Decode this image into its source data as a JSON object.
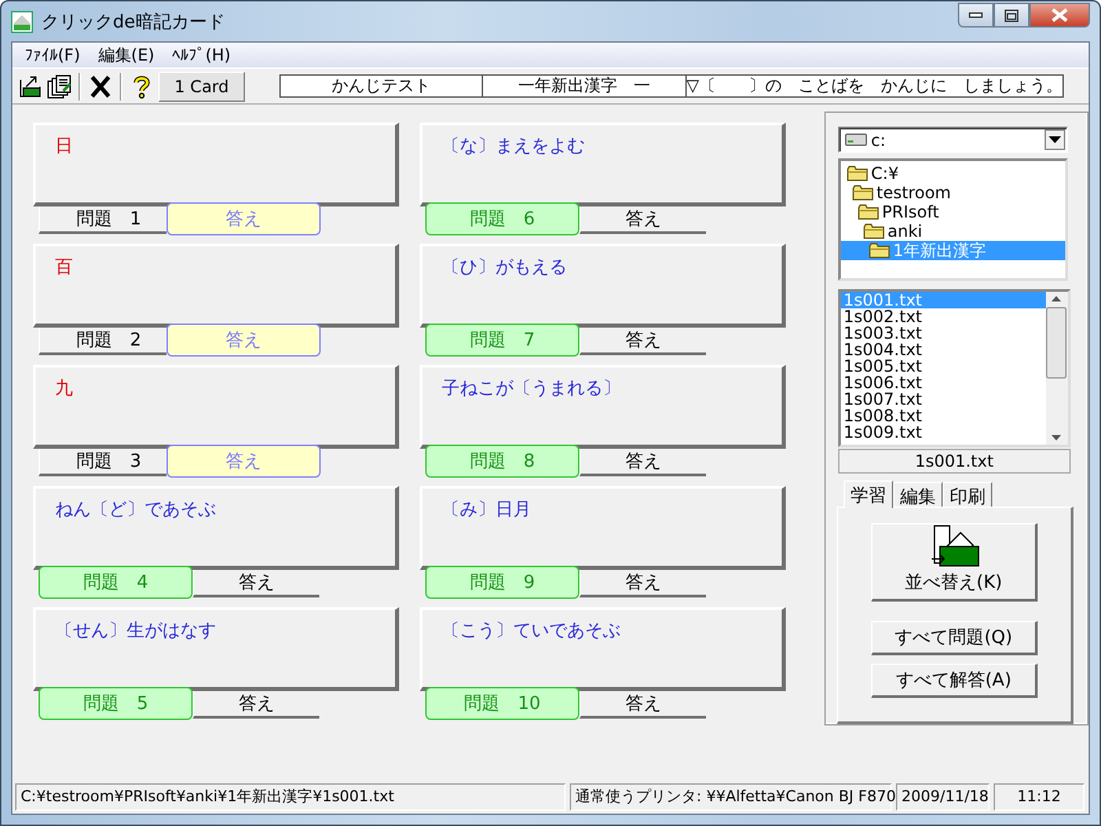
{
  "window": {
    "title": "クリックde暗記カード"
  },
  "menu": [
    {
      "label": "ﾌｧｲﾙ(F)"
    },
    {
      "label": "編集(E)"
    },
    {
      "label": "ﾍﾙﾌﾟ(H)"
    }
  ],
  "toolbar": {
    "card_count": "1 Card",
    "fields": [
      "かんじテスト",
      "一年新出漢字　一",
      "▽〔　　〕の　ことばを　かんじに　しましょう。"
    ]
  },
  "cards": [
    {
      "text": "日",
      "tabs": [
        {
          "label": "問題　1",
          "selected": false
        },
        {
          "label": "答え",
          "selected": true
        }
      ]
    },
    {
      "text": "百",
      "tabs": [
        {
          "label": "問題　2",
          "selected": false
        },
        {
          "label": "答え",
          "selected": true
        }
      ]
    },
    {
      "text": "九",
      "tabs": [
        {
          "label": "問題　3",
          "selected": false
        },
        {
          "label": "答え",
          "selected": true
        }
      ]
    },
    {
      "text": "ねん〔ど〕であそぶ",
      "tabs": [
        {
          "label": "問題　4",
          "selected": true
        },
        {
          "label": "答え",
          "selected": false
        }
      ]
    },
    {
      "text": "〔せん〕生がはなす",
      "tabs": [
        {
          "label": "問題　5",
          "selected": true
        },
        {
          "label": "答え",
          "selected": false
        }
      ]
    },
    {
      "text": "〔な〕まえをよむ",
      "tabs": [
        {
          "label": "問題　6",
          "selected": true
        },
        {
          "label": "答え",
          "selected": false
        }
      ]
    },
    {
      "text": "〔ひ〕がもえる",
      "tabs": [
        {
          "label": "問題　7",
          "selected": true
        },
        {
          "label": "答え",
          "selected": false
        }
      ]
    },
    {
      "text": "子ねこが〔うまれる〕",
      "tabs": [
        {
          "label": "問題　8",
          "selected": true
        },
        {
          "label": "答え",
          "selected": false
        }
      ]
    },
    {
      "text": "〔み〕日月",
      "tabs": [
        {
          "label": "問題　9",
          "selected": true
        },
        {
          "label": "答え",
          "selected": false
        }
      ]
    },
    {
      "text": "〔こう〕ていであそぶ",
      "tabs": [
        {
          "label": "問題　10",
          "selected": true
        },
        {
          "label": "答え",
          "selected": false
        }
      ]
    }
  ],
  "sidebar": {
    "drive": "c:",
    "folders": [
      {
        "label": "C:¥",
        "selected": false,
        "children": [
          {
            "label": "testroom",
            "selected": false,
            "children": [
              {
                "label": "PRIsoft",
                "selected": false,
                "children": [
                  {
                    "label": "anki",
                    "selected": false,
                    "children": [
                      {
                        "label": "1年新出漢字",
                        "selected": true
                      }
                    ]
                  }
                ]
              }
            ]
          }
        ]
      }
    ],
    "files": [
      {
        "label": "1s001.txt",
        "selected": true
      },
      {
        "label": "1s002.txt",
        "selected": false
      },
      {
        "label": "1s003.txt",
        "selected": false
      },
      {
        "label": "1s004.txt",
        "selected": false
      },
      {
        "label": "1s005.txt",
        "selected": false
      },
      {
        "label": "1s006.txt",
        "selected": false
      },
      {
        "label": "1s007.txt",
        "selected": false
      },
      {
        "label": "1s008.txt",
        "selected": false
      },
      {
        "label": "1s009.txt",
        "selected": false
      }
    ],
    "file_name": "1s001.txt",
    "tabs": [
      {
        "label": "学習",
        "selected": true
      },
      {
        "label": "編集",
        "selected": false
      },
      {
        "label": "印刷",
        "selected": false
      }
    ],
    "buttons": [
      "並べ替え(K)",
      "すべて問題(Q)",
      "すべて解答(A)"
    ]
  },
  "status_bar": {
    "path": "C:¥testroom¥PRIsoft¥anki¥1年新出漢字¥1s001.txt",
    "printer": "通常使うプリンタ: ¥¥Alfetta¥Canon BJ F870",
    "date": "2009/11/18",
    "time": "11:12"
  }
}
